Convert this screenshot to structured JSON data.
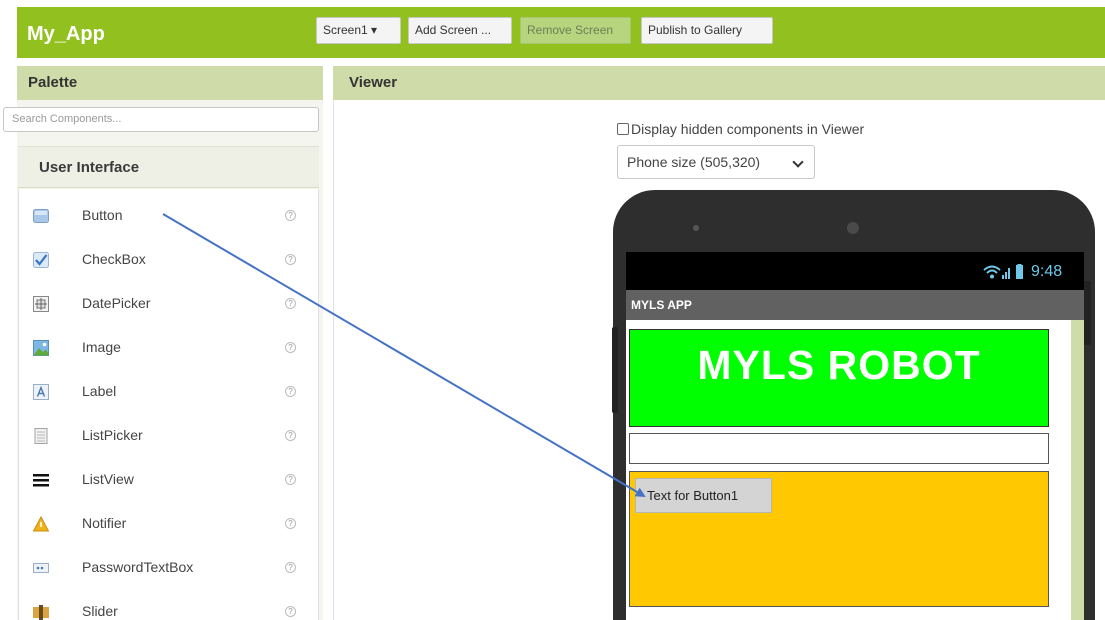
{
  "app": {
    "title": "My_App"
  },
  "toolbar": {
    "screen_select": "Screen1 ▾",
    "add_screen": "Add Screen ...",
    "remove_screen": "Remove Screen",
    "publish": "Publish to Gallery"
  },
  "palette": {
    "title": "Palette",
    "search_placeholder": "Search Components...",
    "category": "User Interface",
    "help_glyph": "?",
    "items": [
      {
        "label": "Button",
        "icon": "button-icon"
      },
      {
        "label": "CheckBox",
        "icon": "checkbox-icon"
      },
      {
        "label": "DatePicker",
        "icon": "datepicker-icon"
      },
      {
        "label": "Image",
        "icon": "image-icon"
      },
      {
        "label": "Label",
        "icon": "label-icon"
      },
      {
        "label": "ListPicker",
        "icon": "listpicker-icon"
      },
      {
        "label": "ListView",
        "icon": "listview-icon"
      },
      {
        "label": "Notifier",
        "icon": "notifier-icon"
      },
      {
        "label": "PasswordTextBox",
        "icon": "passwordtextbox-icon"
      },
      {
        "label": "Slider",
        "icon": "slider-icon"
      }
    ]
  },
  "viewer": {
    "title": "Viewer",
    "hidden_components_label": "Display hidden components in Viewer",
    "phone_size": "Phone size (505,320)"
  },
  "phone": {
    "time": "9:48",
    "app_title": "MYLS APP",
    "heading": "MYLS ROBOT",
    "button_text": "Text for Button1"
  },
  "colors": {
    "brand_green": "#92c11f",
    "panel_header": "#cfdba8",
    "heading_bg": "#00ff00",
    "arrangement_bg": "#ffc800",
    "arrow": "#4472c4"
  }
}
